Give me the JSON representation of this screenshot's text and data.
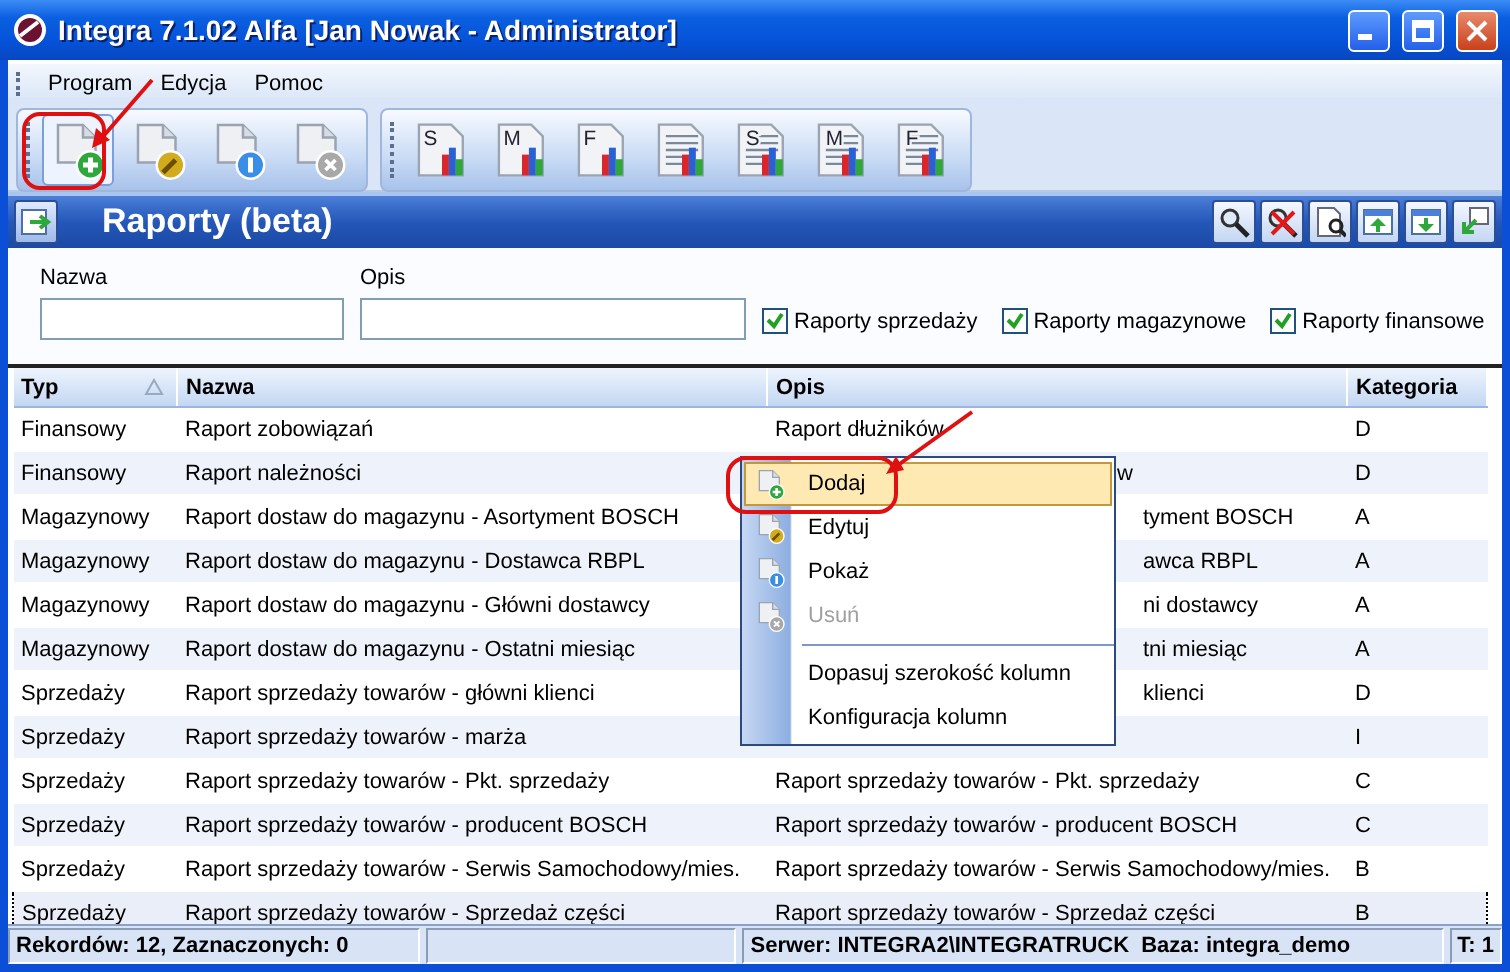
{
  "window": {
    "title": "Integra 7.1.02 Alfa [Jan Nowak - Administrator]"
  },
  "menu": [
    {
      "label": "Program"
    },
    {
      "label": "Edycja"
    },
    {
      "label": "Pomoc"
    }
  ],
  "toolbars": [
    {
      "items": [
        {
          "kind": "add",
          "highlighted": true
        },
        {
          "kind": "edit",
          "highlighted": false
        },
        {
          "kind": "info",
          "highlighted": false
        },
        {
          "kind": "delete",
          "highlighted": false
        }
      ]
    },
    {
      "items": [
        {
          "kind": "chart",
          "letter": "S"
        },
        {
          "kind": "chart",
          "letter": "M"
        },
        {
          "kind": "chart",
          "letter": "F"
        },
        {
          "kind": "list"
        },
        {
          "kind": "list",
          "letter": "S"
        },
        {
          "kind": "list",
          "letter": "M"
        },
        {
          "kind": "list",
          "letter": "F"
        }
      ]
    }
  ],
  "panel": {
    "title": "Raporty (beta)"
  },
  "filters": {
    "fields": [
      {
        "label": "Nazwa"
      },
      {
        "label": "Opis"
      }
    ],
    "checkboxes": [
      {
        "label": "Raporty sprzedaży",
        "checked": true
      },
      {
        "label": "Raporty magazynowe",
        "checked": true
      },
      {
        "label": "Raporty finansowe",
        "checked": true
      }
    ]
  },
  "table": {
    "columns": [
      {
        "label": "Typ",
        "sorted": true
      },
      {
        "label": "Nazwa",
        "sorted": false
      },
      {
        "label": "Opis",
        "sorted": false
      },
      {
        "label": "Kategoria",
        "sorted": false
      }
    ],
    "rows": [
      {
        "typ": "Finansowy",
        "nazwa": "Raport zobowiązań",
        "opis": "Raport dłużników",
        "opis_covered": false,
        "kategoria": "D",
        "selected": false
      },
      {
        "typ": "Finansowy",
        "nazwa": "Raport należności",
        "opis": "w",
        "opis_covered": true,
        "kategoria": "D",
        "selected": false
      },
      {
        "typ": "Magazynowy",
        "nazwa": "Raport dostaw do magazynu - Asortyment BOSCH",
        "opis": "tyment BOSCH",
        "opis_covered": true,
        "kategoria": "A",
        "selected": false
      },
      {
        "typ": "Magazynowy",
        "nazwa": "Raport dostaw do magazynu - Dostawca RBPL",
        "opis": "awca RBPL",
        "opis_covered": true,
        "kategoria": "A",
        "selected": false
      },
      {
        "typ": "Magazynowy",
        "nazwa": "Raport dostaw do magazynu - Główni dostawcy",
        "opis": "ni dostawcy",
        "opis_covered": true,
        "kategoria": "A",
        "selected": false
      },
      {
        "typ": "Magazynowy",
        "nazwa": "Raport dostaw do magazynu - Ostatni miesiąc",
        "opis": "tni miesiąc",
        "opis_covered": true,
        "kategoria": "A",
        "selected": false
      },
      {
        "typ": "Sprzedaży",
        "nazwa": "Raport sprzedaży towarów - główni klienci",
        "opis": "klienci",
        "opis_covered": true,
        "kategoria": "D",
        "selected": false
      },
      {
        "typ": "Sprzedaży",
        "nazwa": "Raport sprzedaży towarów - marża",
        "kategoria": "I",
        "selected": false
      },
      {
        "typ": "Sprzedaży",
        "nazwa": "Raport sprzedaży towarów - Pkt. sprzedaży",
        "opis": "Raport sprzedaży towarów - Pkt. sprzedaży",
        "opis_covered": false,
        "kategoria": "C",
        "selected": false
      },
      {
        "typ": "Sprzedaży",
        "nazwa": "Raport sprzedaży towarów - producent BOSCH",
        "opis": "Raport sprzedaży towarów - producent BOSCH",
        "opis_covered": false,
        "kategoria": "C",
        "selected": false
      },
      {
        "typ": "Sprzedaży",
        "nazwa": "Raport sprzedaży towarów - Serwis Samochodowy/mies.",
        "opis": "Raport sprzedaży towarów - Serwis Samochodowy/mies.",
        "opis_covered": false,
        "kategoria": "B",
        "selected": false
      },
      {
        "typ": "Sprzedaży",
        "nazwa": "Raport sprzedaży towarów - Sprzedaż części",
        "opis": "Raport sprzedaży towarów - Sprzedaż części",
        "opis_covered": false,
        "kategoria": "B",
        "selected": true
      }
    ]
  },
  "context_menu": {
    "items": [
      {
        "kind": "add",
        "label": "Dodaj",
        "selected": true,
        "disabled": false
      },
      {
        "kind": "edit",
        "label": "Edytuj",
        "selected": false,
        "disabled": false
      },
      {
        "kind": "show",
        "label": "Pokaż",
        "selected": false,
        "disabled": false
      },
      {
        "kind": "delete",
        "label": "Usuń",
        "selected": false,
        "disabled": true
      },
      {
        "kind": "separator"
      },
      {
        "kind": "plain",
        "label": "Dopasuj szerokość kolumn",
        "selected": false,
        "disabled": false
      },
      {
        "kind": "plain",
        "label": "Konfiguracja kolumn",
        "selected": false,
        "disabled": false
      }
    ]
  },
  "status_bar": {
    "records": "Rekordów: 12, Zaznaczonych: 0",
    "server": "Serwer: INTEGRA2\\INTEGRATRUCK",
    "database": "Baza: integra_demo",
    "t": "T: 1"
  }
}
